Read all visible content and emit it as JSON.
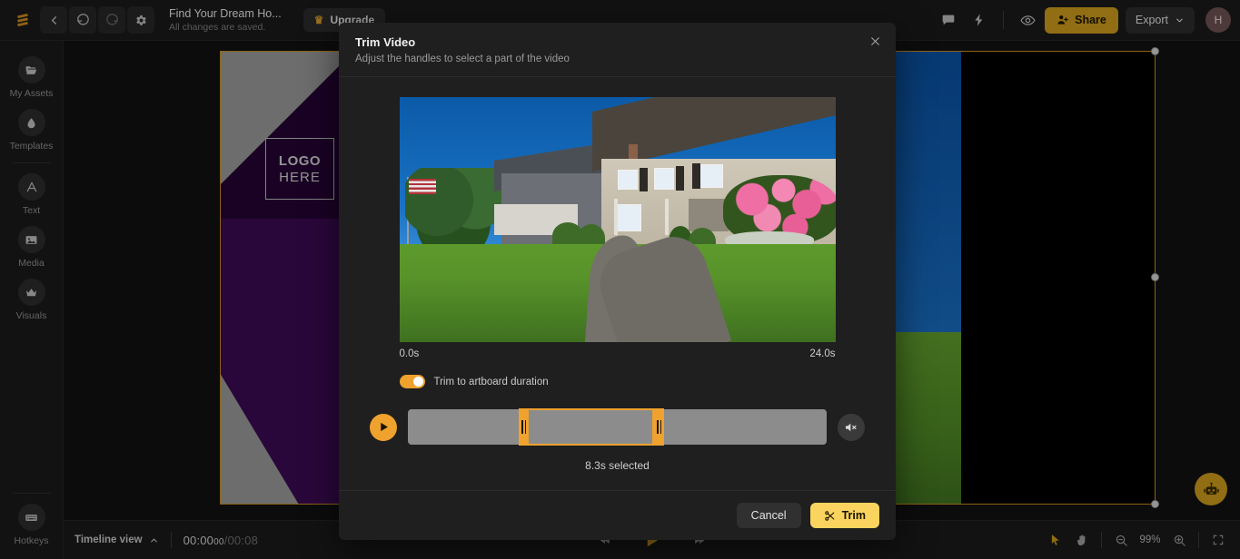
{
  "topbar": {
    "logo_icon": "brand-logo-icon",
    "back_icon": "chevron-left-icon",
    "undo_icon": "undo-icon",
    "redo_icon": "redo-icon",
    "settings_icon": "gear-icon",
    "doc_title": "Find Your Dream Ho...",
    "doc_status": "All changes are saved.",
    "upgrade_label": "Upgrade",
    "crown_icon": "crown-icon",
    "comment_icon": "comment-icon",
    "bolt_icon": "lightning-bolt-icon",
    "preview_icon": "eye-icon",
    "share_label": "Share",
    "share_icon": "add-person-icon",
    "export_label": "Export",
    "export_caret_icon": "chevron-down-icon",
    "avatar_initial": "H",
    "share_color": "#c9971c"
  },
  "sidebar": {
    "items": [
      {
        "label": "My Assets",
        "icon": "folder-icon"
      },
      {
        "label": "Templates",
        "icon": "droplet-icon"
      },
      {
        "label": "Text",
        "icon": "letter-a-icon"
      },
      {
        "label": "Media",
        "icon": "image-icon"
      },
      {
        "label": "Visuals",
        "icon": "crown-icon"
      }
    ],
    "bottom": {
      "label": "Hotkeys",
      "icon": "keyboard-icon"
    }
  },
  "canvas": {
    "slide_logo_line1": "LOGO",
    "slide_logo_line2": "HERE",
    "ai_assistant_icon": "robot-icon",
    "selection_color": "#c28a22"
  },
  "modal": {
    "title": "Trim Video",
    "subtitle": "Adjust the handles to select a part of the video",
    "close_icon": "close-icon",
    "start_time": "0.0s",
    "end_time": "24.0s",
    "toggle_label": "Trim to artboard duration",
    "toggle_on": true,
    "play_icon": "play-icon",
    "mute_icon": "speaker-mute-icon",
    "selection_text": "8.3s selected",
    "cancel_label": "Cancel",
    "trim_label": "Trim",
    "trim_icon": "scissors-icon",
    "accent_color": "#f0a22e",
    "trim_button_color": "#fad45e"
  },
  "bottombar": {
    "timeline_view_label": "Timeline view",
    "timeline_caret_icon": "chevron-up-icon",
    "current_time": "00:00",
    "current_frames": "00",
    "time_divider": "/",
    "total_time": "00:08",
    "prev_icon": "skip-back-icon",
    "play_icon": "play-icon",
    "next_icon": "skip-forward-icon",
    "select_tool_icon": "cursor-arrow-icon",
    "pan_tool_icon": "hand-icon",
    "zoom_out_icon": "zoom-out-icon",
    "zoom_level": "99%",
    "zoom_in_icon": "zoom-in-icon",
    "fit_icon": "fit-screen-icon"
  }
}
